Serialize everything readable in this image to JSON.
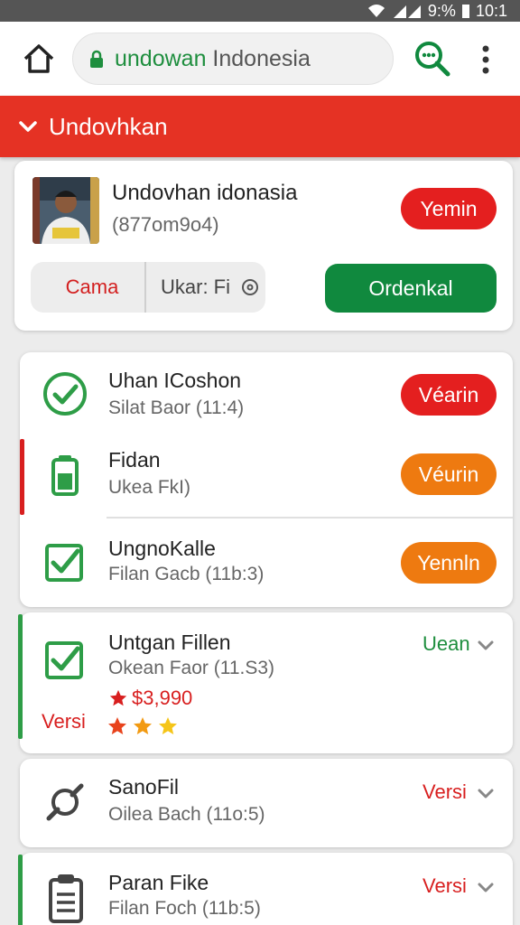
{
  "status_bar": {
    "battery": "9:%",
    "time": "10:1"
  },
  "browser": {
    "url_host": "undowan",
    "url_rest": " Indonesia",
    "icons": {
      "home": "home-icon",
      "lock": "lock-icon",
      "search": "search-zoom-icon",
      "menu": "overflow-menu-icon"
    }
  },
  "header": {
    "title": "Undovhkan"
  },
  "profile": {
    "name": "Undovhan idonasia",
    "phone": "(877om9o4)",
    "verify_label": "Yemin",
    "segment_left": "Cama",
    "segment_right": "Ukar: Fi",
    "order_label": "Ordenkal"
  },
  "list": [
    {
      "title": "Uhan ICoshon",
      "subtitle": "Silat Baor (11:4)",
      "action": "Véarin",
      "action_color": "#e41f1f",
      "icon": "check-circle-icon"
    },
    {
      "title": "Fidan",
      "subtitle": "Ukea FkI)",
      "action": "Véurin",
      "action_color": "#ee7a10",
      "icon": "battery-icon"
    },
    {
      "title": "UngnoKalle",
      "subtitle": "Filan Gacb (11b:3)",
      "action": "Yennln",
      "action_color": "#ee7a10",
      "icon": "checkbox-icon"
    }
  ],
  "items": [
    {
      "title": "Untgan Fillen",
      "subtitle": "Okean Faor (11.S3)",
      "link": "Uean",
      "link_color": "#1e8e3e",
      "price": "$3,990",
      "side_label": "Versi",
      "rating": 3,
      "icon": "checkbox-icon"
    },
    {
      "title": "SanoFil",
      "subtitle": "Oilea Bach (11o:5)",
      "link": "Versi",
      "link_color": "#d81f1f",
      "icon": "wrench-icon"
    },
    {
      "title": "Paran Fike",
      "subtitle": "Filan Foch (11b:5)",
      "link": "Versi",
      "link_color": "#d81f1f",
      "icon": "clipboard-icon"
    }
  ]
}
